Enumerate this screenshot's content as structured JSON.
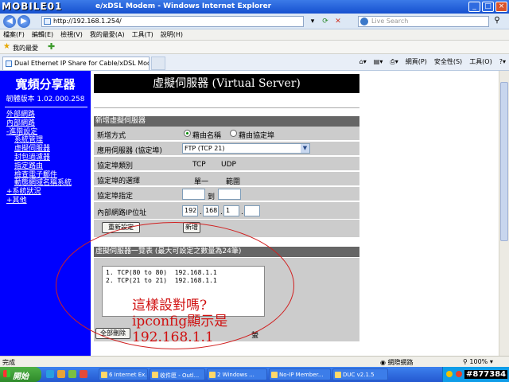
{
  "browser": {
    "logo": "MOBILE01",
    "title": "e/xDSL Modem - Windows Internet Explorer",
    "address": "http://192.168.1.254/",
    "search_placeholder": "Live Search",
    "menu": [
      "檔案(F)",
      "編輯(E)",
      "檢視(V)",
      "我的最愛(A)",
      "工具(T)",
      "說明(H)"
    ],
    "favorites_label": "我的最愛",
    "tab_title": "Dual Ethernet IP Share for Cable/xDSL Modem",
    "tools": {
      "page": "網頁(P)",
      "security": "安全性(S)",
      "tools": "工具(O)"
    },
    "status_done": "完成",
    "status_zone": "網際網路",
    "zoom": "100%"
  },
  "sidebar": {
    "brand": "寬頻分享器",
    "firmware": "韌體版本 1.02.000.258",
    "items": [
      {
        "label": "外部網路",
        "sub": false
      },
      {
        "label": "內部網路",
        "sub": false
      },
      {
        "label": "-進階設定",
        "sub": false
      },
      {
        "label": "系統管理",
        "sub": true
      },
      {
        "label": "虛擬伺服器",
        "sub": true
      },
      {
        "label": "封包過濾器",
        "sub": true
      },
      {
        "label": "指定路由",
        "sub": true
      },
      {
        "label": "檢查電子郵件",
        "sub": true
      },
      {
        "label": "動態網域名稱系統",
        "sub": true
      },
      {
        "label": "+系統狀況",
        "sub": false
      },
      {
        "label": "+其他",
        "sub": false
      }
    ]
  },
  "main": {
    "banner": "虛擬伺服器 (Virtual Server)",
    "add_section": "新增虛擬伺服器",
    "add_method_label": "新增方式",
    "by_name": "藉由名稱",
    "by_protocol": "藉由協定埠",
    "server_label": "應用伺服器 (協定埠)",
    "server_value": "FTP (TCP 21)",
    "protocol_type_label": "協定埠類別",
    "tcp": "TCP",
    "udp": "UDP",
    "protocol_select_label": "協定埠的選擇",
    "single": "單一",
    "range": "範圍",
    "protocol_assign_label": "協定埠指定",
    "to": "到",
    "lan_ip_label": "內部網路IP位址",
    "ip": [
      "192",
      "168",
      "1",
      ""
    ],
    "reset_button": "重新設定",
    "add_button": "新增",
    "list_section": "虛擬伺服器一覽表 (最大可設定之數量為24筆)",
    "list_items": [
      "1. TCP(80 to 80)  192.168.1.1",
      "2. TCP(21 to 21)  192.168.1.1"
    ],
    "delete_all_button": "全部刪除",
    "bottom_trailing": "螢"
  },
  "annotation": {
    "line1": "這樣設對嗎?",
    "line2": "ipconfig顯示是",
    "line3": "192.168.1.1",
    "color": "#d01010"
  },
  "taskbar": {
    "start": "開始",
    "tasks": [
      "6 Internet Ex...",
      "收件匣 - Outl...",
      "2 Windows ...",
      "No-IP Member...",
      "DUC v2.1.5"
    ]
  },
  "watermark": "#877384"
}
